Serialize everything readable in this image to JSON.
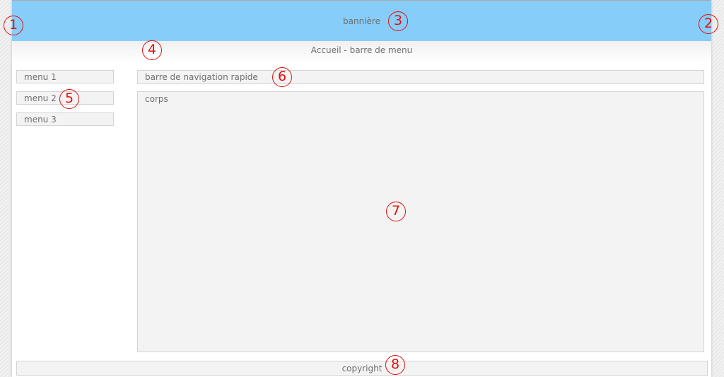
{
  "banner": {
    "label": "bannière"
  },
  "menubar": {
    "label": "Accueil - barre de menu"
  },
  "sidebar": {
    "items": [
      {
        "label": "menu 1"
      },
      {
        "label": "menu 2"
      },
      {
        "label": "menu 3"
      }
    ]
  },
  "navbar": {
    "label": "barre de navigation rapide"
  },
  "body": {
    "label": "corps"
  },
  "footer": {
    "label": "copyright"
  },
  "markers": [
    "1",
    "2",
    "3",
    "4",
    "5",
    "6",
    "7",
    "8"
  ],
  "colors": {
    "banner": "#87cdf9",
    "marker": "#e01010",
    "box": "#f3f3f3"
  }
}
